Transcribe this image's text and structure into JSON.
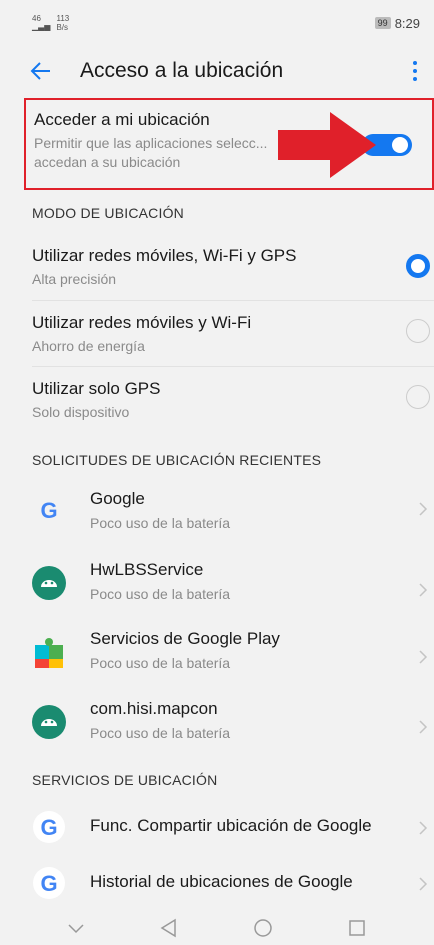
{
  "status": {
    "signal": "46",
    "net_speed": "113",
    "net_unit": "B/s",
    "battery": "99",
    "time": "8:29"
  },
  "appbar": {
    "title": "Acceso a la ubicación"
  },
  "location_toggle": {
    "title": "Acceder a mi ubicación",
    "subtitle": "Permitir que las aplicaciones selecc... accedan a su ubicación",
    "enabled": true
  },
  "mode_section": {
    "header": "MODO DE UBICACIÓN",
    "options": [
      {
        "title": "Utilizar redes móviles, Wi-Fi y GPS",
        "subtitle": "Alta precisión",
        "selected": true
      },
      {
        "title": "Utilizar redes móviles y Wi-Fi",
        "subtitle": "Ahorro de energía",
        "selected": false
      },
      {
        "title": "Utilizar solo GPS",
        "subtitle": "Solo dispositivo",
        "selected": false
      }
    ]
  },
  "recent_section": {
    "header": "SOLICITUDES DE UBICACIÓN RECIENTES",
    "apps": [
      {
        "name": "Google",
        "usage": "Poco uso de la batería",
        "icon": "google-icon"
      },
      {
        "name": "HwLBSService",
        "usage": "Poco uso de la batería",
        "icon": "android-icon"
      },
      {
        "name": "Servicios de Google Play",
        "usage": "Poco uso de la batería",
        "icon": "puzzle-icon"
      },
      {
        "name": "com.hisi.mapcon",
        "usage": "Poco uso de la batería",
        "icon": "android-icon"
      }
    ]
  },
  "services_section": {
    "header": "SERVICIOS DE UBICACIÓN",
    "items": [
      {
        "name": "Func. Compartir ubicación de Google",
        "icon": "google-icon"
      },
      {
        "name": "Historial de ubicaciones de Google",
        "icon": "google-icon"
      }
    ]
  },
  "colors": {
    "accent": "#1478f0",
    "highlight_border": "#e0202a",
    "arrow": "#e0202a"
  }
}
